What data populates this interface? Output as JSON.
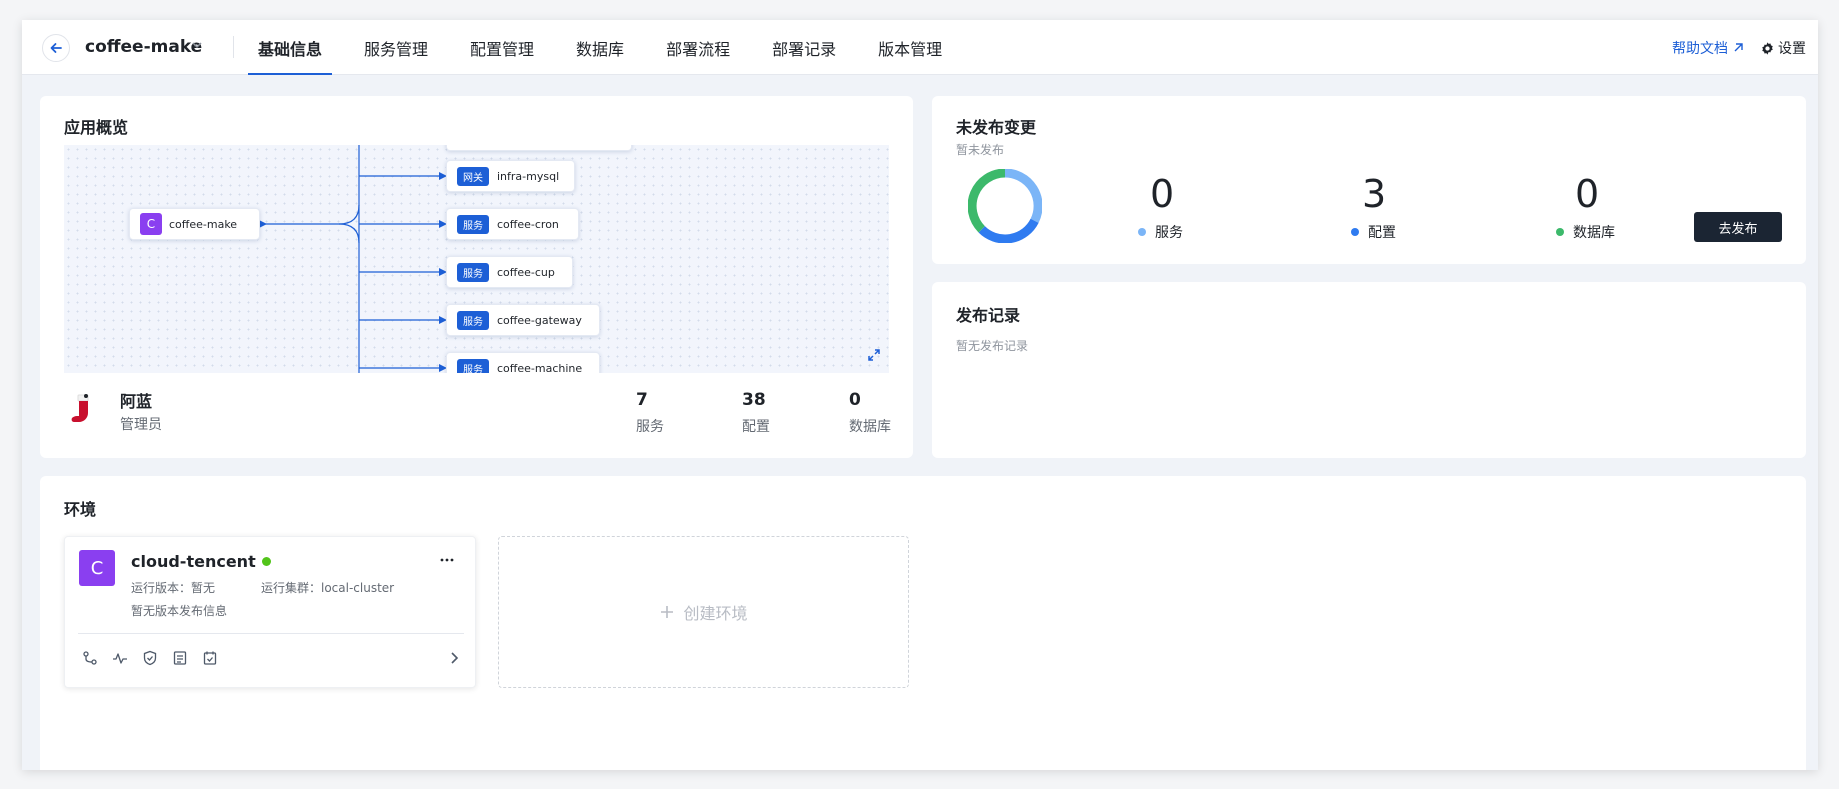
{
  "header": {
    "app_name": "coffee-make",
    "tabs": [
      {
        "label": "基础信息",
        "active": true
      },
      {
        "label": "服务管理"
      },
      {
        "label": "配置管理"
      },
      {
        "label": "数据库"
      },
      {
        "label": "部署流程"
      },
      {
        "label": "部署记录"
      },
      {
        "label": "版本管理"
      }
    ],
    "help_label": "帮助文档",
    "settings_label": "设置"
  },
  "overview": {
    "title": "应用概览",
    "root_node": {
      "avatar": "C",
      "name": "coffee-make"
    },
    "nodes": [
      {
        "tag": "网关",
        "name": "infra-mysql"
      },
      {
        "tag": "服务",
        "name": "coffee-cron"
      },
      {
        "tag": "服务",
        "name": "coffee-cup"
      },
      {
        "tag": "服务",
        "name": "coffee-gateway"
      },
      {
        "tag": "服务",
        "name": "coffee-machine"
      }
    ],
    "owner": {
      "name": "阿蓝",
      "role": "管理员"
    },
    "stats": [
      {
        "value": "7",
        "label": "服务"
      },
      {
        "value": "38",
        "label": "配置"
      },
      {
        "value": "0",
        "label": "数据库"
      }
    ]
  },
  "unpublished": {
    "title": "未发布变更",
    "subtitle": "暂未发布",
    "items": [
      {
        "value": "0",
        "label": "服务",
        "color": "#7bb5f7"
      },
      {
        "value": "3",
        "label": "配置",
        "color": "#2f7bf0"
      },
      {
        "value": "0",
        "label": "数据库",
        "color": "#3cb96b"
      }
    ],
    "publish_label": "去发布"
  },
  "records": {
    "title": "发布记录",
    "empty_text": "暂无发布记录"
  },
  "environments": {
    "title": "环境",
    "card": {
      "avatar": "C",
      "name": "cloud-tencent",
      "version_text": "运行版本：暂无",
      "cluster_text": "运行集群：local-cluster",
      "release_info": "暂无版本发布信息"
    },
    "create_label": "创建环境"
  }
}
